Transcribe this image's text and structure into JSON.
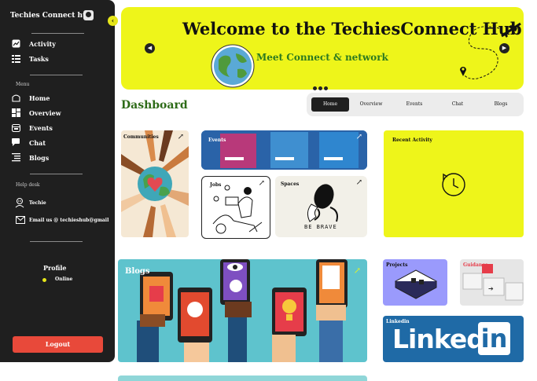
{
  "sidebar": {
    "app_title": "Techies Connect hub",
    "theme_icon": "moon-icon",
    "primary_items": [
      {
        "label": "Activity",
        "icon": "trend-chart-icon"
      },
      {
        "label": "Tasks",
        "icon": "task-list-icon"
      }
    ],
    "menu_heading": "Menu",
    "menu_items": [
      {
        "label": "Home",
        "icon": "home-icon"
      },
      {
        "label": "Overview",
        "icon": "grid-icon"
      },
      {
        "label": "Events",
        "icon": "calendar-icon"
      },
      {
        "label": "Chat",
        "icon": "chat-icon"
      },
      {
        "label": "Blogs",
        "icon": "list-icon"
      }
    ],
    "help_heading": "Help desk",
    "help_items": [
      {
        "label": "Techie",
        "icon": "robot-icon"
      },
      {
        "label": "Email us @ techieshub@gmail",
        "icon": "mail-icon"
      }
    ],
    "profile_label": "Profile",
    "status_label": "Online",
    "status_color": "#e6e61a",
    "logout_label": "Logout"
  },
  "banner": {
    "title": "Welcome to the TechiesConnect Hub",
    "subtitle": "Meet Connect & network",
    "prev_icon": "chevron-left-icon",
    "next_icon": "chevron-right-icon",
    "accent": "#eef51a"
  },
  "dashboard": {
    "title": "Dashboard",
    "tabs": [
      "Home",
      "Overview",
      "Events",
      "Chat",
      "Blogs"
    ],
    "active_tab": "Home"
  },
  "cards": {
    "communities": "Communities",
    "events": "Events",
    "jobs": "Jobs",
    "spaces": "Spaces",
    "spaces_caption": "BE BRAVE",
    "recent_activity": "Recent Activity",
    "blogs": "Blogs",
    "projects": "Projects",
    "guidance": "Guidance",
    "linkedin_label": "Linkedin",
    "linkedin_logo": "Linked",
    "linkedin_in": "in"
  }
}
